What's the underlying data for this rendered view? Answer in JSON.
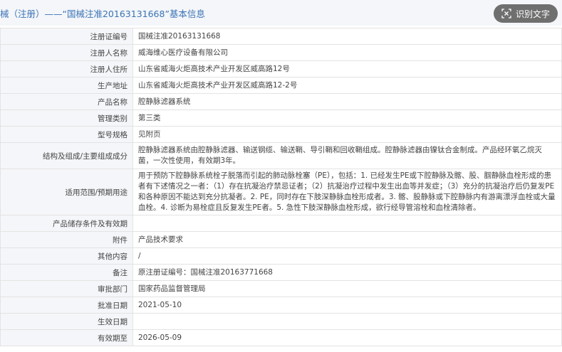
{
  "header": {
    "title": "械（注册）——“国械注准20163131668”基本信息",
    "ocr_button": "识别文字"
  },
  "rows": [
    {
      "label": "注册证编号",
      "value": "国械注准20163131668"
    },
    {
      "label": "注册人名称",
      "value": "威海维心医疗设备有限公司"
    },
    {
      "label": "注册人住所",
      "value": "山东省威海火炬高技术产业开发区威高路12号"
    },
    {
      "label": "生产地址",
      "value": "山东省威海火炬高技术产业开发区威高路12-2号"
    },
    {
      "label": "产品名称",
      "value": "腔静脉滤器系统"
    },
    {
      "label": "管理类别",
      "value": "第三类"
    },
    {
      "label": "型号规格",
      "value": "见附页"
    },
    {
      "label": "结构及组成/主要组成成分",
      "value": "腔静脉滤器系统由腔静脉滤器、输送钢缆、输送鞘、导引鞘和回收鞘组成。腔静脉滤器由镍钛合金制成。产品经环氧乙烷灭菌，一次性使用，有效期3年。"
    },
    {
      "label": "适用范围/预期用途",
      "value": "用于预防下腔静脉系统栓子脱落而引起的肺动脉栓塞（PE），包括：1. 已经发生PE或下腔静脉及髂、股、腘静脉血栓形成的患者有下述情况之一者：（1）存在抗凝治疗禁忌证者；（2）抗凝治疗过程中发生出血等并发症；（3）充分的抗凝治疗后仍复发PE和各种原因不能达到充分抗凝者。2. PE，同时存在下肢深静脉血栓形成者。3. 髂、股静脉或下腔静脉内有游离漂浮血栓或大量血栓。4. 诊断为易栓症且反复发生PE者。5. 急性下肢深静脉血栓形成，欲行经导管溶栓和血栓清除者。"
    },
    {
      "label": "产品储存条件及有效期",
      "value": ""
    },
    {
      "label": "附件",
      "value": "产品技术要求"
    },
    {
      "label": "其他内容",
      "value": "/"
    },
    {
      "label": "备注",
      "value": "原注册证编号：国械注准20163771668"
    },
    {
      "label": "审批部门",
      "value": "国家药品监督管理局"
    },
    {
      "label": "批准日期",
      "value": "2021-05-10"
    },
    {
      "label": "生效日期",
      "value": ""
    },
    {
      "label": "有效期至",
      "value": "2026-05-09"
    }
  ]
}
